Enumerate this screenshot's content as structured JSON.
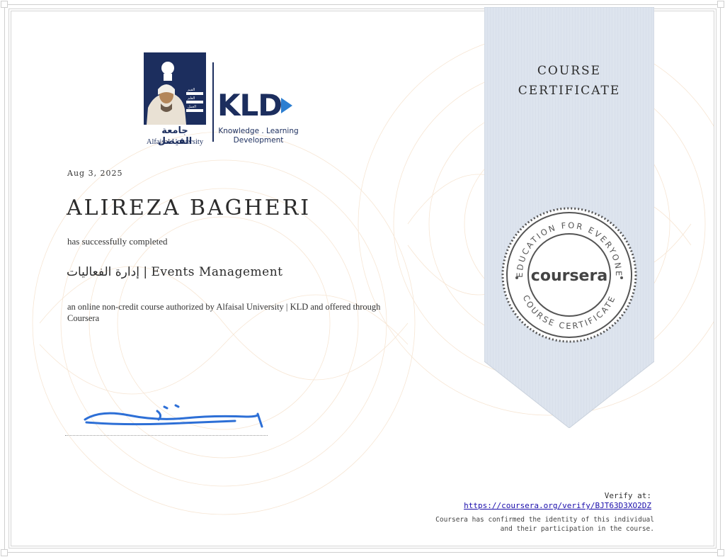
{
  "logo": {
    "institution_ar": "جامعة الفيصل",
    "institution_en": "Alfaisal University",
    "partner_mark": "KLD",
    "partner_line1": "Knowledge . Learning",
    "partner_line2": "Development",
    "panel_words": [
      "القيم",
      "العلم",
      "العمل"
    ]
  },
  "certificate": {
    "date": "Aug 3, 2025",
    "recipient": "ALIREZA BAGHERI",
    "completed_text": "has successfully completed",
    "course_name": "إدارة الفعاليات | Events Management",
    "description": "an online non-credit course authorized by Alfaisal University | KLD and offered through Coursera"
  },
  "ribbon": {
    "title_line1": "COURSE",
    "title_line2": "CERTIFICATE"
  },
  "seal": {
    "top_text": "EDUCATION FOR EVERYONE",
    "center_text": "coursera",
    "bottom_text": "COURSE CERTIFICATE"
  },
  "verification": {
    "label": "Verify at:",
    "url": "https://coursera.org/verify/BJT63D3XO2DZ",
    "confirmation": "Coursera has confirmed the identity of this individual and their participation in the course."
  },
  "colors": {
    "brand_navy": "#1c2e5e",
    "ribbon_fill": "#dde4ee",
    "seal_gray": "#555555",
    "signature_blue": "#2d6fd6",
    "link_blue": "#1a0dab",
    "guilloche_tint": "#f6e3cf"
  }
}
